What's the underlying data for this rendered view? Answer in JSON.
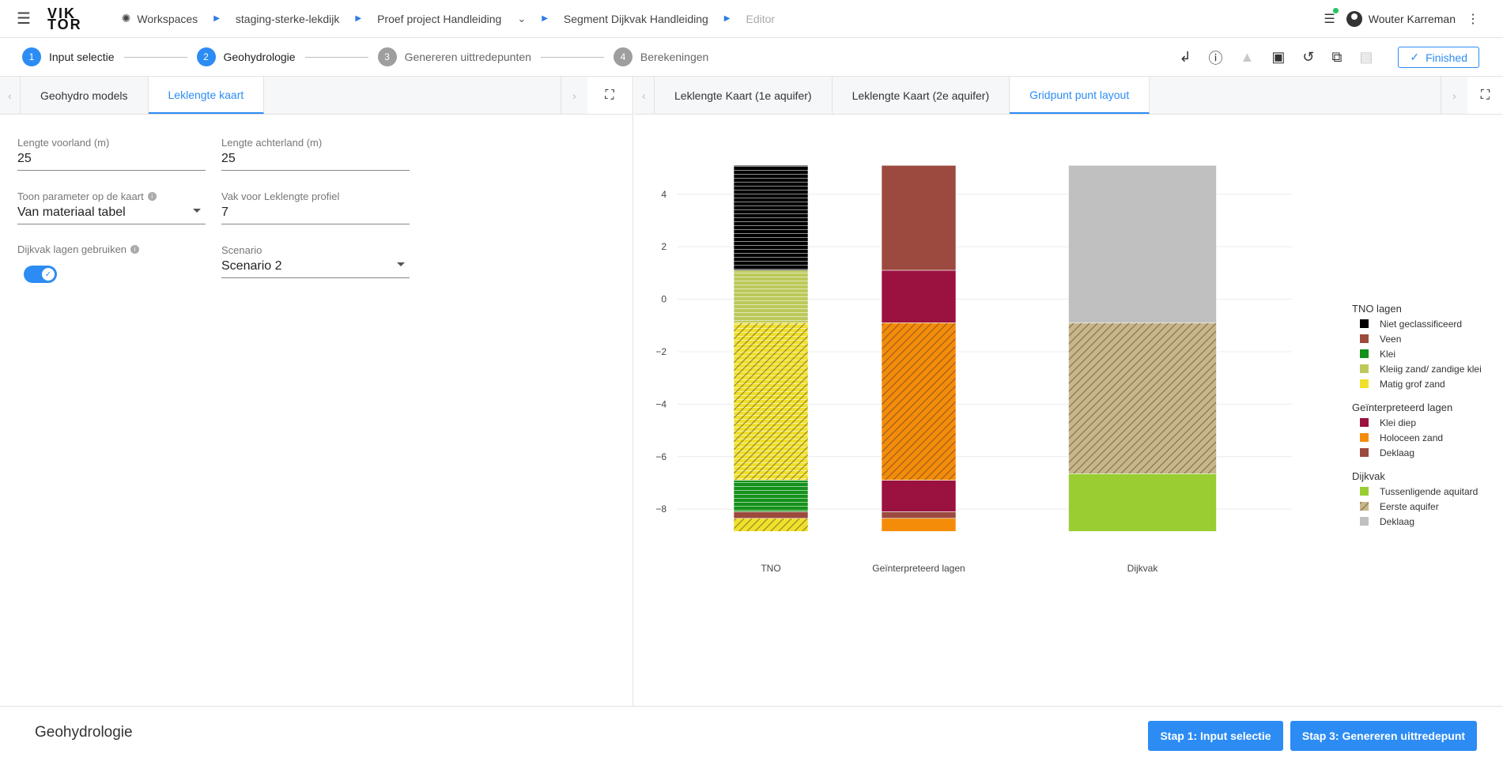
{
  "topbar": {
    "logo_line1": "VIK",
    "logo_line2": "TOR",
    "breadcrumbs": [
      {
        "label": "Workspaces"
      },
      {
        "label": "staging-sterke-lekdijk"
      },
      {
        "label": "Proef project Handleiding"
      },
      {
        "label": "Segment Dijkvak Handleiding"
      },
      {
        "label": "Editor"
      }
    ],
    "user_name": "Wouter Karreman"
  },
  "steps": [
    {
      "num": "1",
      "label": "Input selectie",
      "state": "active"
    },
    {
      "num": "2",
      "label": "Geohydrologie",
      "state": "active"
    },
    {
      "num": "3",
      "label": "Genereren uittredepunten",
      "state": "inactive"
    },
    {
      "num": "4",
      "label": "Berekeningen",
      "state": "inactive"
    }
  ],
  "finished_label": "Finished",
  "left_tabs": [
    {
      "label": "Geohydro models"
    },
    {
      "label": "Leklengte kaart"
    }
  ],
  "right_tabs": [
    {
      "label": "Leklengte Kaart (1e aquifer)"
    },
    {
      "label": "Leklengte Kaart (2e aquifer)"
    },
    {
      "label": "Gridpunt punt layout"
    }
  ],
  "form": {
    "lengte_voorland": {
      "label": "Lengte voorland (m)",
      "value": "25"
    },
    "lengte_achterland": {
      "label": "Lengte achterland (m)",
      "value": "25"
    },
    "toon_parameter": {
      "label": "Toon parameter op de kaart",
      "value": "Van materiaal tabel"
    },
    "vak_profiel": {
      "label": "Vak voor Leklengte profiel",
      "value": "7"
    },
    "dijkvak_lagen": {
      "label": "Dijkvak lagen gebruiken",
      "value": true
    },
    "scenario": {
      "label": "Scenario",
      "value": "Scenario 2"
    }
  },
  "footer": {
    "title": "Geohydrologie",
    "btn_prev": "Stap 1: Input selectie",
    "btn_next": "Stap 3: Genereren uittredepunt"
  },
  "chart_data": {
    "type": "bar",
    "subtype": "stacked",
    "categories": [
      "TNO",
      "Geïnterpreteerd lagen",
      "Dijkvak"
    ],
    "ylim": [
      -9.2,
      5.8
    ],
    "yticks": [
      4,
      2,
      0,
      -2,
      -4,
      -6,
      -8
    ],
    "grid": true,
    "legend_position": "right",
    "segments": [
      {
        "category": "TNO",
        "bottom": 1.1,
        "top": 5.1,
        "series": "Niet geclassificeerd",
        "group": "TNO lagen",
        "color": "#000000",
        "pattern": "hlines"
      },
      {
        "category": "TNO",
        "bottom": -0.9,
        "top": 1.1,
        "series": "Kleiig zand/ zandige klei",
        "group": "TNO lagen",
        "color": "#bcc95a",
        "pattern": "hlines"
      },
      {
        "category": "TNO",
        "bottom": -6.9,
        "top": -0.9,
        "series": "Matig grof zand",
        "group": "TNO lagen",
        "color": "#f0e02a",
        "pattern": "hlines-diag"
      },
      {
        "category": "TNO",
        "bottom": -8.1,
        "top": -6.9,
        "series": "Klei",
        "group": "TNO lagen",
        "color": "#14911a",
        "pattern": "hlines"
      },
      {
        "category": "TNO",
        "bottom": -8.35,
        "top": -8.1,
        "series": "Veen",
        "group": "TNO lagen",
        "color": "#9b4a3c",
        "pattern": "none"
      },
      {
        "category": "TNO",
        "bottom": -8.85,
        "top": -8.35,
        "series": "Matig grof zand",
        "group": "TNO lagen",
        "color": "#f0e02a",
        "pattern": "diag"
      },
      {
        "category": "Geïnterpreteerd lagen",
        "bottom": 1.1,
        "top": 5.1,
        "series": "Deklaag",
        "group": "Geïnterpreteerd lagen",
        "color": "#9c4a3f",
        "pattern": "none"
      },
      {
        "category": "Geïnterpreteerd lagen",
        "bottom": -0.9,
        "top": 1.1,
        "series": "Klei diep",
        "group": "Geïnterpreteerd lagen",
        "color": "#9b1140",
        "pattern": "none"
      },
      {
        "category": "Geïnterpreteerd lagen",
        "bottom": -6.9,
        "top": -0.9,
        "series": "Holoceen zand",
        "group": "Geïnterpreteerd lagen",
        "color": "#f48c0a",
        "pattern": "diag"
      },
      {
        "category": "Geïnterpreteerd lagen",
        "bottom": -8.1,
        "top": -6.9,
        "series": "Klei diep",
        "group": "Geïnterpreteerd lagen",
        "color": "#9b1140",
        "pattern": "none"
      },
      {
        "category": "Geïnterpreteerd lagen",
        "bottom": -8.35,
        "top": -8.1,
        "series": "Deklaag",
        "group": "Geïnterpreteerd lagen",
        "color": "#9c4a3f",
        "pattern": "none"
      },
      {
        "category": "Geïnterpreteerd lagen",
        "bottom": -8.85,
        "top": -8.35,
        "series": "Holoceen zand",
        "group": "Geïnterpreteerd lagen",
        "color": "#f48c0a",
        "pattern": "none"
      },
      {
        "category": "Dijkvak",
        "bottom": -0.9,
        "top": 5.1,
        "series": "Deklaag",
        "group": "Dijkvak",
        "color": "#c0c0c0",
        "pattern": "none"
      },
      {
        "category": "Dijkvak",
        "bottom": -6.65,
        "top": -0.9,
        "series": "Eerste aquifer",
        "group": "Dijkvak",
        "color": "#c8b68a",
        "pattern": "diag"
      },
      {
        "category": "Dijkvak",
        "bottom": -8.85,
        "top": -6.65,
        "series": "Tussenligende aquitard",
        "group": "Dijkvak",
        "color": "#9acd32",
        "pattern": "none"
      }
    ],
    "legend": [
      {
        "title": "TNO lagen",
        "items": [
          {
            "name": "Niet geclassificeerd",
            "color": "#000000",
            "pattern": "none"
          },
          {
            "name": "Veen",
            "color": "#9b4a3c",
            "pattern": "none"
          },
          {
            "name": "Klei",
            "color": "#14911a",
            "pattern": "none"
          },
          {
            "name": "Kleiig zand/ zandige klei",
            "color": "#bcc95a",
            "pattern": "none"
          },
          {
            "name": "Matig grof zand",
            "color": "#f0e02a",
            "pattern": "none"
          }
        ]
      },
      {
        "title": "Geïnterpreteerd lagen",
        "items": [
          {
            "name": "Klei diep",
            "color": "#9b1140",
            "pattern": "none"
          },
          {
            "name": "Holoceen zand",
            "color": "#f48c0a",
            "pattern": "none"
          },
          {
            "name": "Deklaag",
            "color": "#9c4a3f",
            "pattern": "none"
          }
        ]
      },
      {
        "title": "Dijkvak",
        "items": [
          {
            "name": "Tussenligende aquitard",
            "color": "#9acd32",
            "pattern": "none"
          },
          {
            "name": "Eerste aquifer",
            "color": "#c8b68a",
            "pattern": "diag"
          },
          {
            "name": "Deklaag",
            "color": "#c0c0c0",
            "pattern": "none"
          }
        ]
      }
    ]
  }
}
